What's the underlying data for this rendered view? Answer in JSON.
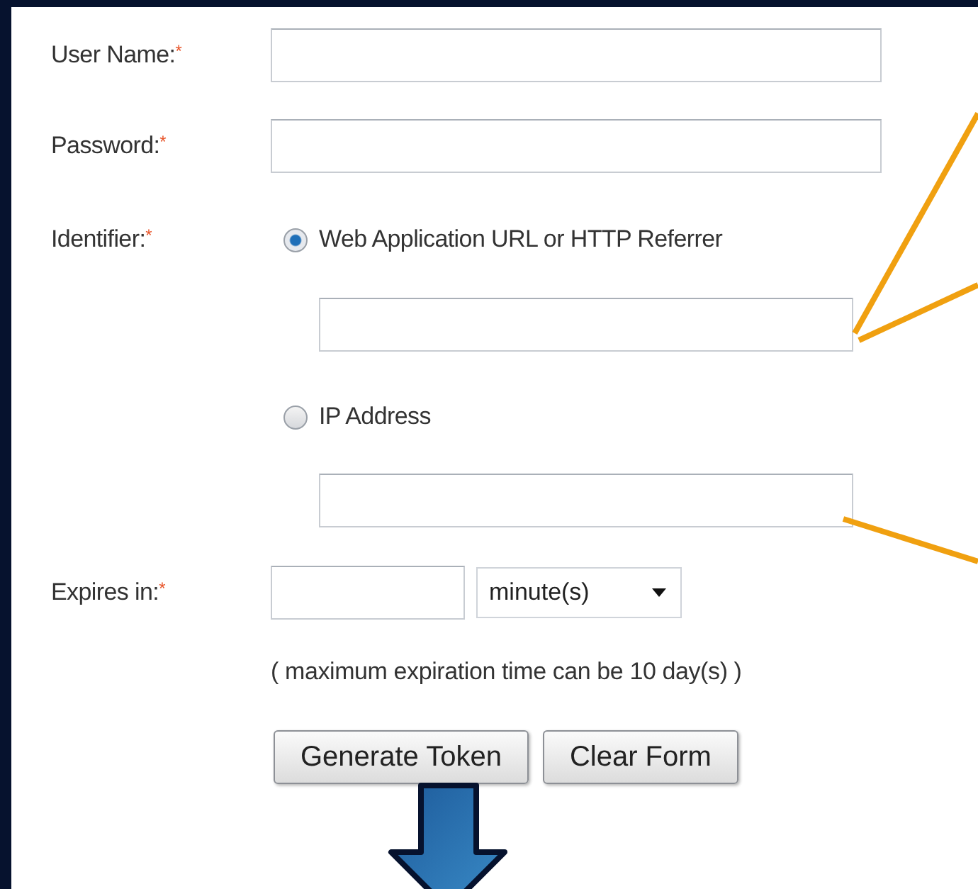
{
  "fields": [
    {
      "label": "User Name:",
      "required_mark": "*"
    },
    {
      "label": "Password:",
      "required_mark": "*"
    }
  ],
  "identifier": {
    "label": "Identifier:",
    "required_mark": "*",
    "options": [
      {
        "label": "Web Application URL or HTTP Referrer",
        "selected": true
      },
      {
        "label": "IP Address",
        "selected": false
      }
    ]
  },
  "expires": {
    "label": "Expires in:",
    "required_mark": "*",
    "unit": "minute(s)",
    "hint": "( maximum expiration time can be 10 day(s) )"
  },
  "buttons": [
    "Generate Token",
    "Clear Form"
  ]
}
